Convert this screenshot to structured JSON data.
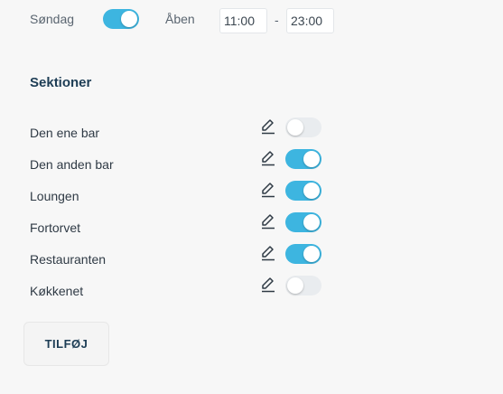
{
  "schedule": {
    "day_label": "Søndag",
    "day_enabled": true,
    "status_label": "Åben",
    "open_from": "11:00",
    "separator": "-",
    "open_to": "23:00"
  },
  "sections": {
    "title": "Sektioner",
    "items": [
      {
        "label": "Den ene bar",
        "enabled": false
      },
      {
        "label": "Den anden bar",
        "enabled": true
      },
      {
        "label": "Loungen",
        "enabled": true
      },
      {
        "label": "Fortorvet",
        "enabled": true
      },
      {
        "label": "Restauranten",
        "enabled": true
      },
      {
        "label": "Køkkenet",
        "enabled": false
      }
    ],
    "add_button_label": "TILFØJ"
  },
  "icons": {
    "edit": "pencil-edit-icon"
  },
  "colors": {
    "toggle_on": "#3db5e0",
    "toggle_off": "#e9ecef",
    "heading": "#1d3d55",
    "background": "#f7f7f7"
  }
}
